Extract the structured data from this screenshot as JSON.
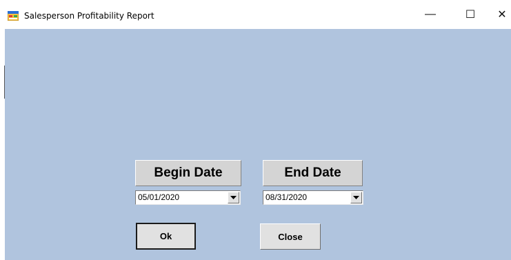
{
  "window": {
    "title": "Salesperson Profitability Report",
    "icon": "app-form-icon",
    "controls": {
      "minimize_glyph": "—",
      "maximize_glyph": "☐",
      "close_glyph": "✕"
    }
  },
  "form": {
    "background_color": "#b0c4de",
    "begin_date": {
      "label": "Begin Date",
      "value": "05/01/2020"
    },
    "end_date": {
      "label": "End Date",
      "value": "08/31/2020"
    },
    "buttons": {
      "ok_label": "Ok",
      "close_label": "Close"
    }
  }
}
